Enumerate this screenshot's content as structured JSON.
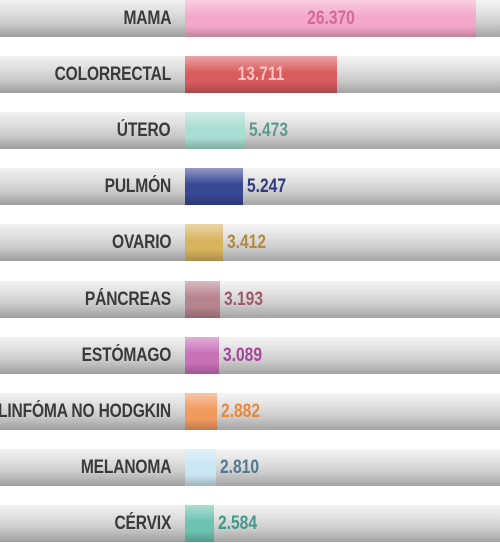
{
  "chart_data": {
    "type": "bar",
    "orientation": "horizontal",
    "xlim": [
      0,
      28500
    ],
    "grid": false,
    "categories": [
      "MAMA",
      "COLORRECTAL",
      "ÚTERO",
      "PULMÓN",
      "OVARIO",
      "PÁNCREAS",
      "ESTÓMAGO",
      "LINFÓMA NO HODGKIN",
      "MELANOMA",
      "CÉRVIX"
    ],
    "values": [
      26370,
      13711,
      5473,
      5247,
      3412,
      3193,
      3089,
      2882,
      2810,
      2584
    ],
    "value_labels": [
      "26.370",
      "13.711",
      "5.473",
      "5.247",
      "3.412",
      "3.193",
      "3.089",
      "2.882",
      "2.810",
      "2.584"
    ],
    "bar_colors": [
      "#f4a8c8",
      "#d95b5e",
      "#a8ddd1",
      "#394894",
      "#d8b35d",
      "#b7838f",
      "#c870b8",
      "#f29a5e",
      "#c9e6f3",
      "#6cc3b0"
    ],
    "label_colors": [
      "#d46a97",
      "#f6c3c0",
      "#5a9a8f",
      "#2e3a82",
      "#b3893a",
      "#9c5a6a",
      "#a8459b",
      "#e8883f",
      "#4f7a92",
      "#3f9a8c"
    ]
  }
}
